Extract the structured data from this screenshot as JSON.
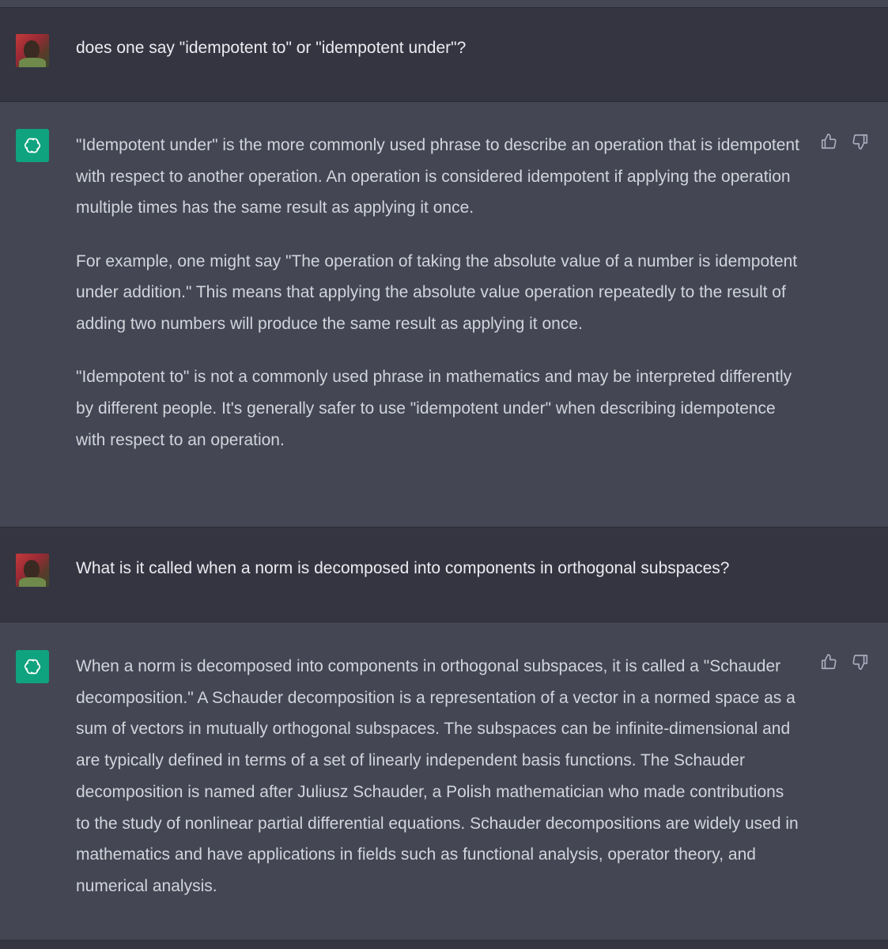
{
  "conversation": {
    "turns": [
      {
        "role": "user",
        "text": "does one say \"idempotent to\" or \"idempotent under\"?"
      },
      {
        "role": "assistant",
        "paragraphs": [
          "\"Idempotent under\" is the more commonly used phrase to describe an operation that is idempotent with respect to another operation. An operation is considered idempotent if applying the operation multiple times has the same result as applying it once.",
          "For example, one might say \"The operation of taking the absolute value of a number is idempotent under addition.\" This means that applying the absolute value operation repeatedly to the result of adding two numbers will produce the same result as applying it once.",
          "\"Idempotent to\" is not a commonly used phrase in mathematics and may be interpreted differently by different people. It's generally safer to use \"idempotent under\" when describing idempotence with respect to an operation."
        ]
      },
      {
        "role": "user",
        "text": "What is it called when a norm is decomposed into components in orthogonal subspaces?"
      },
      {
        "role": "assistant",
        "paragraphs": [
          "When a norm is decomposed into components in orthogonal subspaces, it is called a \"Schauder decomposition.\" A Schauder decomposition is a representation of a vector in a normed space as a sum of vectors in mutually orthogonal subspaces. The subspaces can be infinite-dimensional and are typically defined in terms of a set of linearly independent basis functions. The Schauder decomposition is named after Juliusz Schauder, a Polish mathematician who made contributions to the study of nonlinear partial differential equations. Schauder decompositions are widely used in mathematics and have applications in fields such as functional analysis, operator theory, and numerical analysis."
        ]
      }
    ]
  },
  "icons": {
    "bot_avatar": "openai-logo-icon",
    "thumbs_up": "thumbs-up-icon",
    "thumbs_down": "thumbs-down-icon"
  },
  "colors": {
    "user_bg": "#343541",
    "assistant_bg": "#444654",
    "bot_avatar_bg": "#10a37f",
    "text_primary": "#ececf1",
    "text_secondary": "#d1d5db"
  }
}
